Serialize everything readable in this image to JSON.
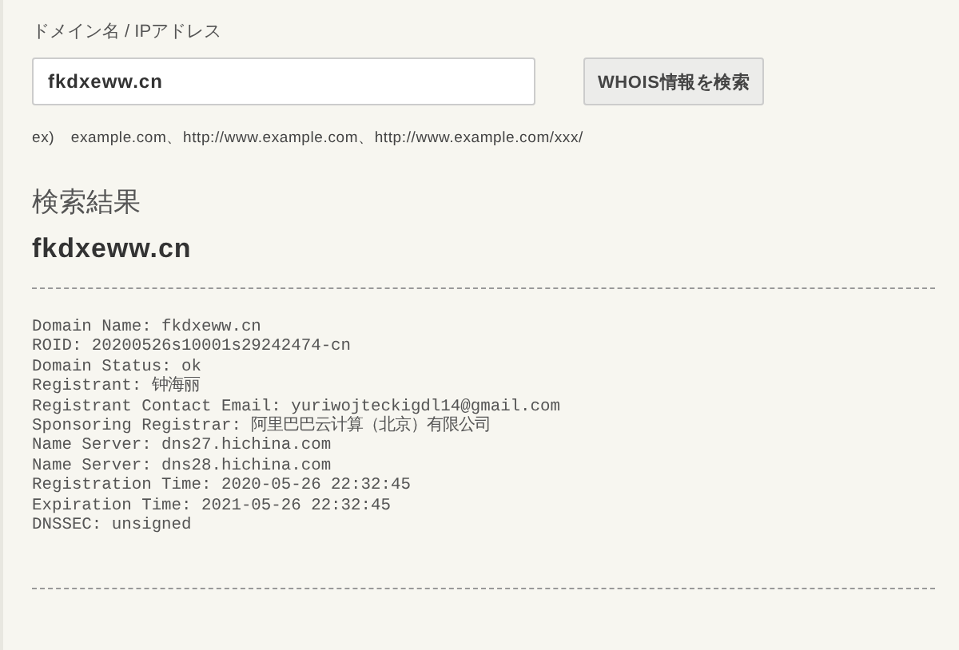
{
  "search": {
    "label": "ドメイン名 / IPアドレス",
    "value": "fkdxeww.cn",
    "button": "WHOIS情報を検索",
    "example": "ex)　example.com、http://www.example.com、http://www.example.com/xxx/"
  },
  "results": {
    "heading": "検索結果",
    "domain": "fkdxeww.cn",
    "lines": [
      "Domain Name: fkdxeww.cn",
      "ROID: 20200526s10001s29242474-cn",
      "Domain Status: ok",
      "Registrant: 钟海丽",
      "Registrant Contact Email: yuriwojteckigdl14@gmail.com",
      "Sponsoring Registrar: 阿里巴巴云计算（北京）有限公司",
      "Name Server: dns27.hichina.com",
      "Name Server: dns28.hichina.com",
      "Registration Time: 2020-05-26 22:32:45",
      "Expiration Time: 2021-05-26 22:32:45",
      "DNSSEC: unsigned"
    ]
  }
}
